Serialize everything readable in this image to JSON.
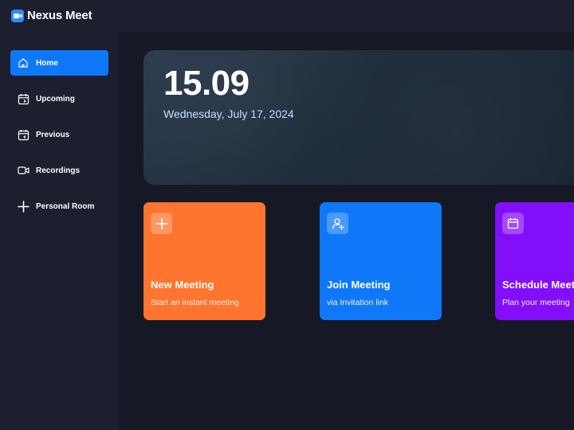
{
  "app": {
    "title": "Nexus Meet",
    "logo_icon": "video-camera-icon",
    "brand_color": "#2d8cff"
  },
  "sidebar": {
    "items": [
      {
        "label": "Home",
        "icon": "home-icon",
        "active": true
      },
      {
        "label": "Upcoming",
        "icon": "calendar-upcoming-icon",
        "active": false
      },
      {
        "label": "Previous",
        "icon": "calendar-previous-icon",
        "active": false
      },
      {
        "label": "Recordings",
        "icon": "video-recording-icon",
        "active": false
      },
      {
        "label": "Personal Room",
        "icon": "plus-icon",
        "active": false
      }
    ],
    "active_color": "#0e78f9"
  },
  "hero": {
    "time": "15.09",
    "date": "Wednesday, July 17, 2024"
  },
  "cards": [
    {
      "title": "New Meeting",
      "subtitle": "Start an instant meeting",
      "color": "#ff742e",
      "icon": "plus-icon"
    },
    {
      "title": "Join Meeting",
      "subtitle": "via Invitation link",
      "color": "#0e78f9",
      "icon": "user-add-icon"
    },
    {
      "title": "Schedule Meeting",
      "subtitle": "Plan your meeting",
      "color": "#830ef9",
      "icon": "calendar-icon"
    }
  ]
}
